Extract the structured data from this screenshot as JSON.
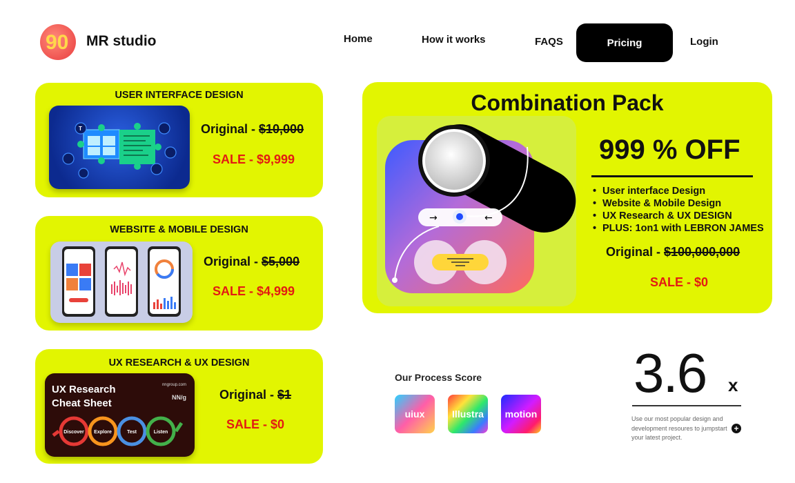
{
  "header": {
    "brand": "MR studio",
    "logo_text": "90",
    "nav": {
      "home": "Home",
      "how": "How it works",
      "faqs": "FAQS",
      "pricing": "Pricing",
      "login": "Login"
    }
  },
  "cards": [
    {
      "title": "USER INTERFACE DESIGN",
      "original_label": "Original - ",
      "original_price": "$10,000",
      "sale": "SALE - $9,999"
    },
    {
      "title": "WEBSITE & MOBILE DESIGN",
      "original_label": "Original - ",
      "original_price": "$5,000",
      "sale": "SALE - $4,999"
    },
    {
      "title": "UX RESEARCH & UX DESIGN",
      "original_label": "Original - ",
      "original_price": "$1",
      "sale": "SALE - $0",
      "thumb": {
        "title_line1": "UX Research",
        "title_line2": "Cheat Sheet",
        "source": "nngroup.com",
        "brand": "NN/g",
        "steps": [
          "Discover",
          "Explore",
          "Test",
          "Listen"
        ]
      }
    }
  ],
  "combo": {
    "title": "Combination Pack",
    "discount": "999 % OFF",
    "features": [
      "User interface Design",
      "Website & Mobile Design",
      "UX Research & UX DESIGN",
      "PLUS: 1on1 with LEBRON JAMES"
    ],
    "original_label": "Original - ",
    "original_price": "$100,000,000",
    "sale": "SALE - $0",
    "arrow_right": "→",
    "arrow_left": "←"
  },
  "process": {
    "title": "Our Process Score",
    "tiles": [
      "uiux",
      "Illustra",
      "motion"
    ],
    "score": "3.6",
    "multiplier": "x",
    "description": "Use our most popular design and development resoures to jumpstart your latest project.",
    "plus": "+"
  },
  "colors": {
    "card_bg": "#e2f501",
    "sale_red": "#e31b12",
    "pricing_button": "#000000"
  }
}
